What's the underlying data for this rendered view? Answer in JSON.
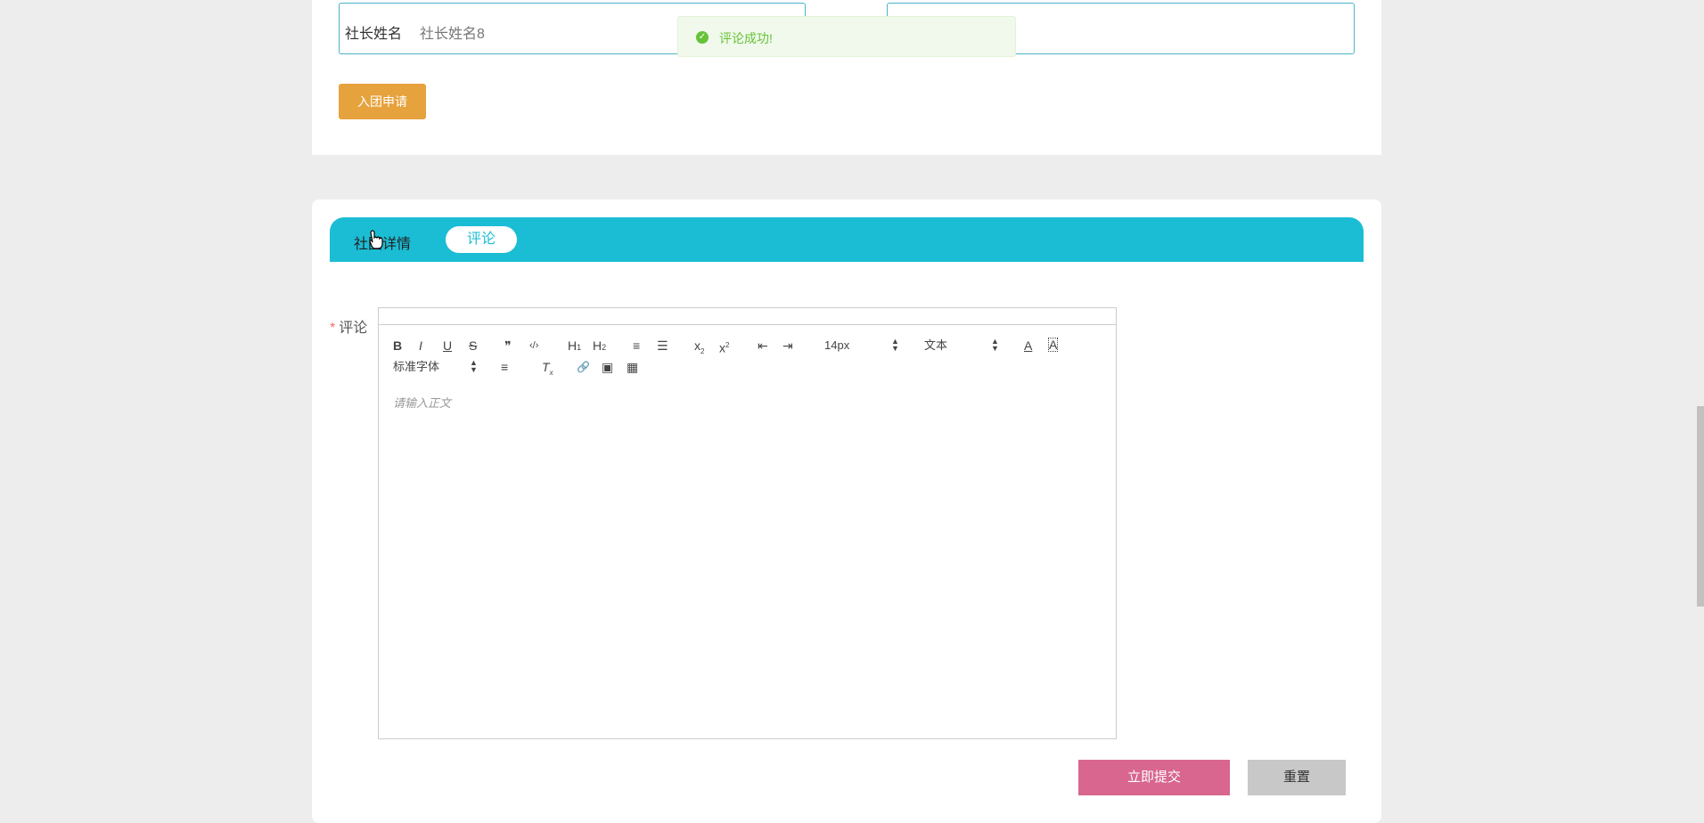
{
  "top_form": {
    "president_label": "社长姓名",
    "president_value": "社长姓名8",
    "join_button": "入团申请"
  },
  "toast": {
    "message": "评论成功!",
    "icon": "check-circle-icon",
    "color": "#67c23a"
  },
  "tabs": [
    {
      "label": "社团详情",
      "active": false
    },
    {
      "label": "评论",
      "active": true
    }
  ],
  "comment_form": {
    "required_mark": "*",
    "label": "评论",
    "placeholder": "请输入正文",
    "toolbar": {
      "bold": "B",
      "italic": "I",
      "underline": "U",
      "strike": "S",
      "blockquote": "❞",
      "code": "‹/›",
      "h1": "H",
      "h1_sub": "1",
      "h2": "H",
      "h2_sub": "2",
      "ordered_list": "≡",
      "bullet_list": "☰",
      "subscript": "x",
      "subscript_mark": "2",
      "superscript": "x",
      "superscript_mark": "2",
      "outdent": "⇤",
      "indent": "⇥",
      "font_size": "14px",
      "header_type": "文本",
      "font_color": "A",
      "background_color": "A",
      "font_family": "标准字体",
      "align": "≡",
      "clean": "T",
      "clean_mark": "x",
      "link": "🔗",
      "image": "▣",
      "video": "▦"
    },
    "submit_button": "立即提交",
    "reset_button": "重置"
  },
  "colors": {
    "accent": "#1bbdd4",
    "join_button": "#e6a23c",
    "submit_button": "#d8668e",
    "reset_button": "#c8c8c8"
  }
}
